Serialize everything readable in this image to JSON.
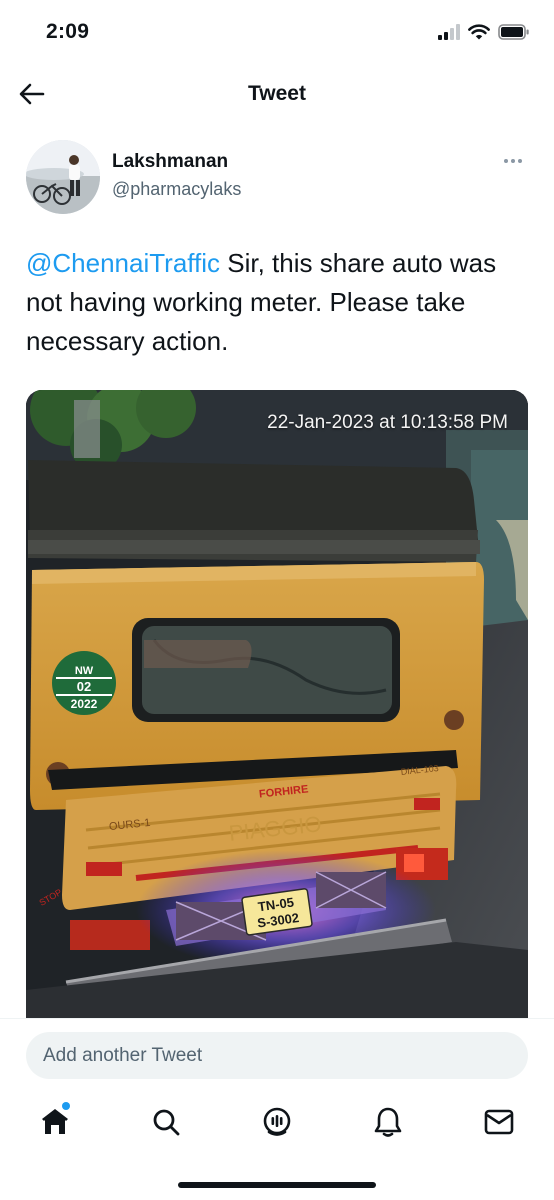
{
  "status_bar": {
    "time": "2:09",
    "icons": [
      "cellular-signal-icon",
      "wifi-icon",
      "battery-icon"
    ]
  },
  "nav": {
    "title": "Tweet",
    "back_icon": "arrow-left-icon"
  },
  "tweet": {
    "author_name": "Lakshmanan",
    "author_handle": "@pharmacylaks",
    "mention": "@ChennaiTraffic",
    "body": " Sir, this share auto was not having working meter. Please take necessary action.",
    "media": {
      "timestamp": "22-Jan-2023 at 10:13:58 PM",
      "sticker_lines": [
        "NW",
        "02",
        "2022"
      ],
      "plate_lines": [
        "TN-05",
        "S-3002"
      ],
      "vehicle_text": [
        "FORHIRE",
        "OURS-1",
        "DIAL-103",
        "PIAGGIO",
        "STOP"
      ]
    }
  },
  "reply": {
    "placeholder": "Add another Tweet"
  },
  "tab_bar": {
    "tabs": [
      "home-icon",
      "search-icon",
      "spaces-icon",
      "notifications-icon",
      "messages-icon"
    ]
  },
  "colors": {
    "accent": "#1d9bf0",
    "text": "#0f1419",
    "secondary_text": "#536471"
  }
}
